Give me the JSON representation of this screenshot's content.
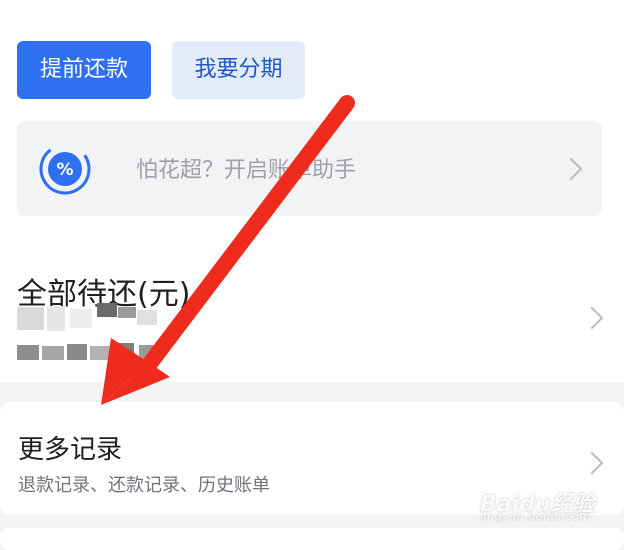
{
  "actions": {
    "prepay_label": "提前还款",
    "installment_label": "我要分期"
  },
  "helper": {
    "text": "怕花超？开启账单助手",
    "icon": "percent-icon"
  },
  "due": {
    "title": "全部待还(元)"
  },
  "records": {
    "title": "更多记录",
    "subtitle": "退款记录、还款记录、历史账单"
  },
  "annotation": {
    "arrow_color": "#ef2b1d"
  },
  "watermark": {
    "main": "Baidu经验",
    "sub": "jingyan.baidu.com"
  },
  "colors": {
    "primary": "#2f6ff2",
    "secondary_bg": "#e3ecfb",
    "secondary_text": "#2258c6"
  }
}
